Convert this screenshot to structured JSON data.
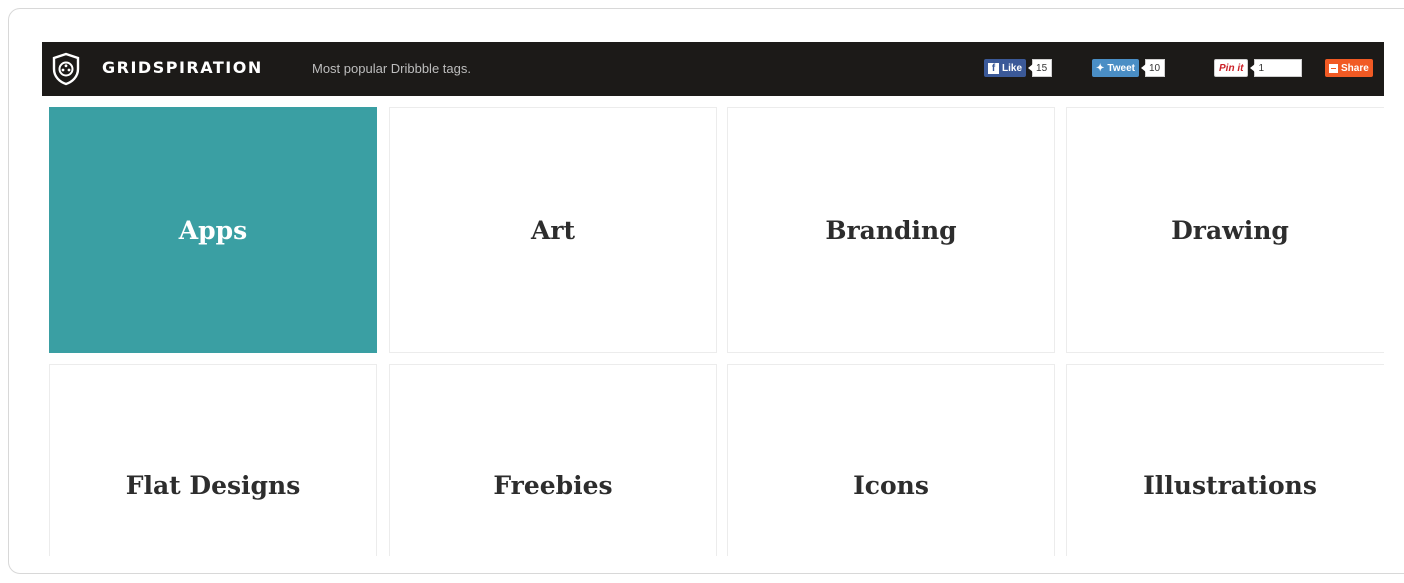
{
  "header": {
    "brand": "GRIDSPIRATION",
    "tagline": "Most popular Dribbble tags."
  },
  "social": {
    "facebook_label": "Like",
    "facebook_count": "15",
    "twitter_label": "Tweet",
    "twitter_count": "10",
    "pinterest_label": "Pin it",
    "pinterest_count": "1",
    "share_label": "Share"
  },
  "tiles": [
    {
      "label": "Apps",
      "active": true
    },
    {
      "label": "Art",
      "active": false
    },
    {
      "label": "Branding",
      "active": false
    },
    {
      "label": "Drawing",
      "active": false
    },
    {
      "label": "Flat Designs",
      "active": false
    },
    {
      "label": "Freebies",
      "active": false
    },
    {
      "label": "Icons",
      "active": false
    },
    {
      "label": "Illustrations",
      "active": false
    }
  ],
  "colors": {
    "accent": "#3a9fa3",
    "topbar": "#1c1a18",
    "facebook": "#3b5998",
    "twitter": "#4a8ec5",
    "pinterest": "#cb2027",
    "share": "#f15a24"
  }
}
